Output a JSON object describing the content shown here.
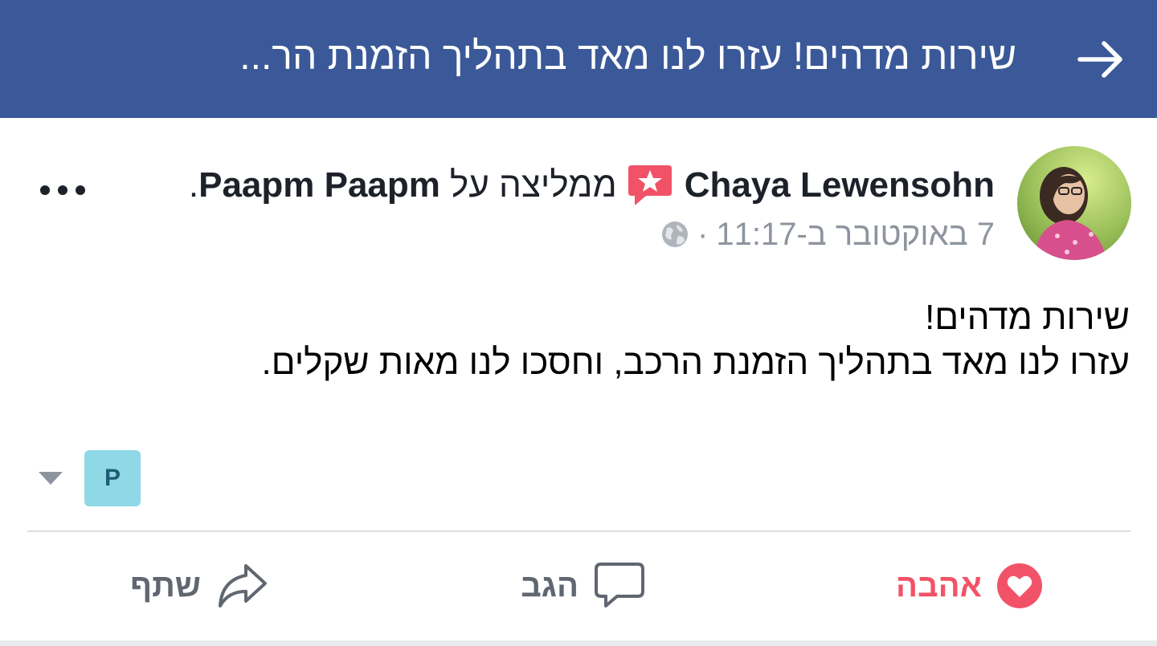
{
  "topbar": {
    "title": "שירות מדהים! עזרו לנו מאד בתהליך הזמנת הר...",
    "background": "#3b5998"
  },
  "post": {
    "author": "Chaya Lewensohn",
    "verb": "ממליצה על",
    "page": "Paapm Paapm",
    "end_punct": ".",
    "date": "7 באוקטובר ב-11:17",
    "separator": "·",
    "privacy_icon": "globe-icon",
    "more_icon": "more-dots-icon",
    "body_lines": [
      "שירות מדהים!",
      "עזרו לנו מאד בתהליך הזמנת הרכב, וחסכו לנו מאות שקלים."
    ]
  },
  "chip": {
    "letter": "P",
    "color": "#8fd8e6"
  },
  "actions": {
    "love": "אהבה",
    "comment": "הגב",
    "share": "שתף",
    "love_color": "#f25268"
  }
}
